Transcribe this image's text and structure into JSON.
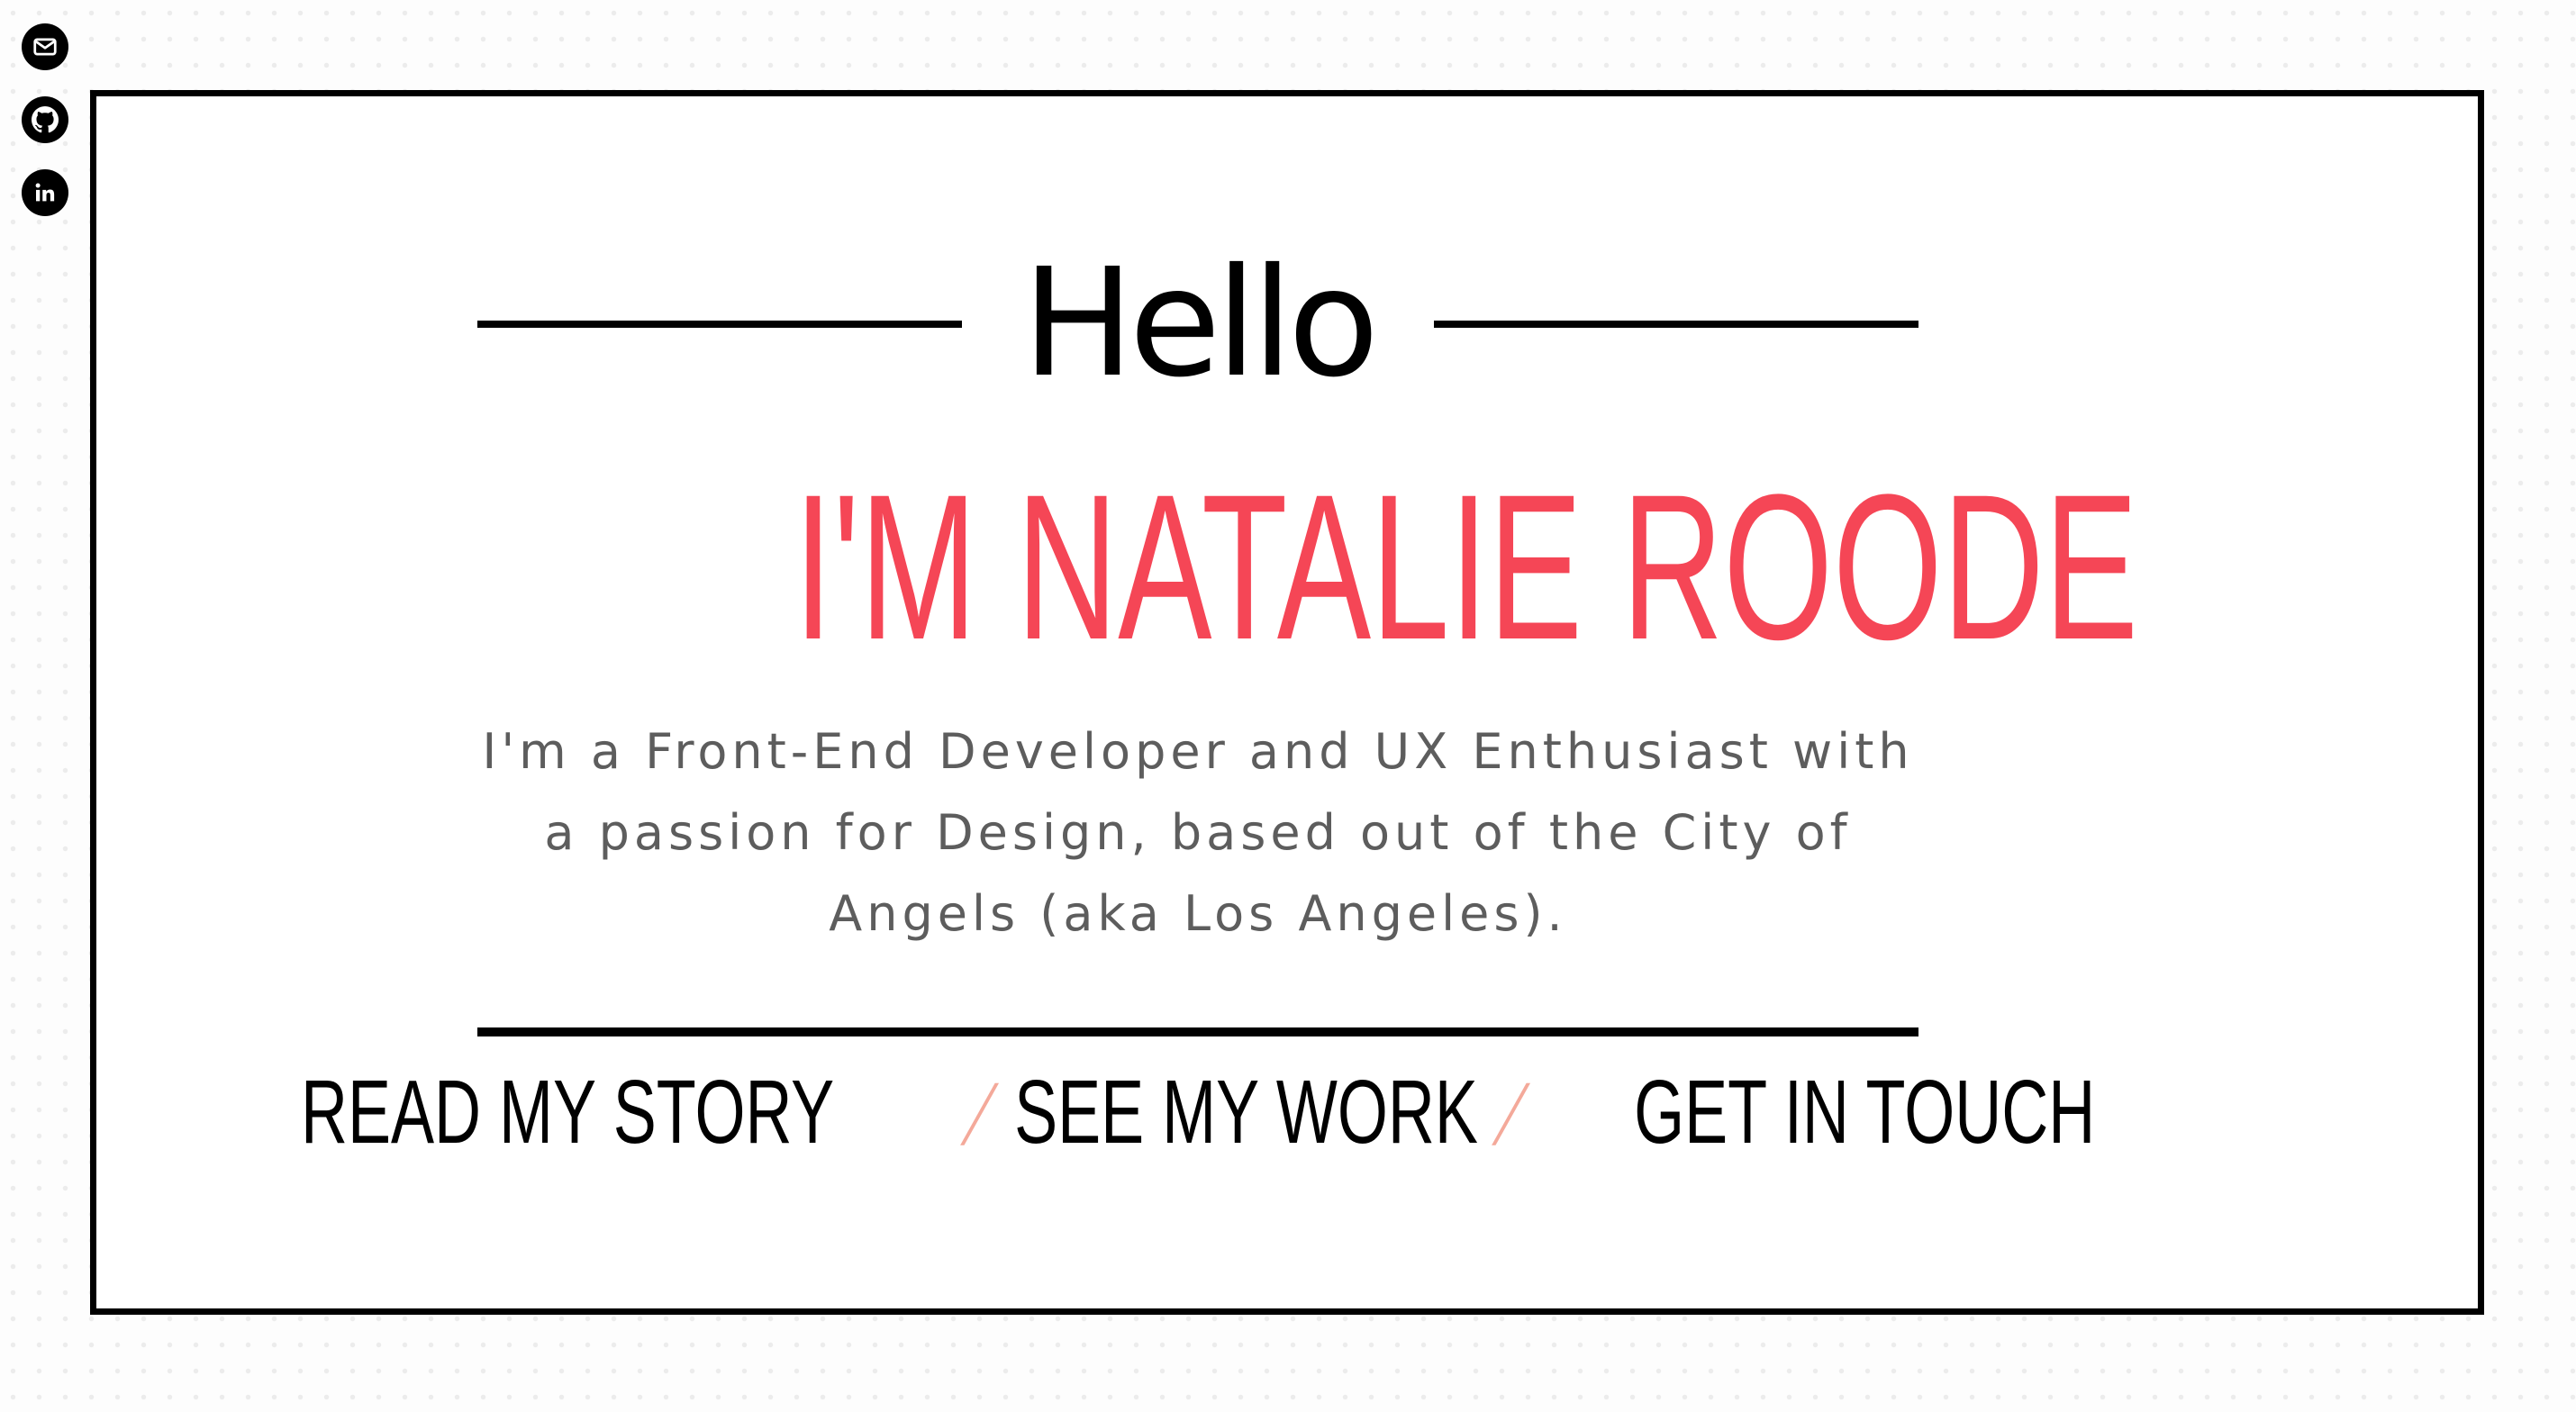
{
  "social": [
    {
      "name": "email",
      "icon": "envelope-icon"
    },
    {
      "name": "github",
      "icon": "github-icon"
    },
    {
      "name": "linkedin",
      "icon": "linkedin-icon"
    }
  ],
  "hero": {
    "greeting": "Hello",
    "name": "I'M NATALIE ROODE",
    "tagline": "I'm a Front-End Developer and UX Enthusiast with a passion for Design, based out of the City of Angels (aka Los Angeles)."
  },
  "nav": {
    "links": [
      "READ MY STORY",
      "SEE MY WORK",
      "GET IN TOUCH"
    ],
    "separator": "/"
  },
  "colors": {
    "accent": "#f54656",
    "separator": "#f4a99a",
    "text": "#000000",
    "body_text": "#5d5d5d"
  }
}
